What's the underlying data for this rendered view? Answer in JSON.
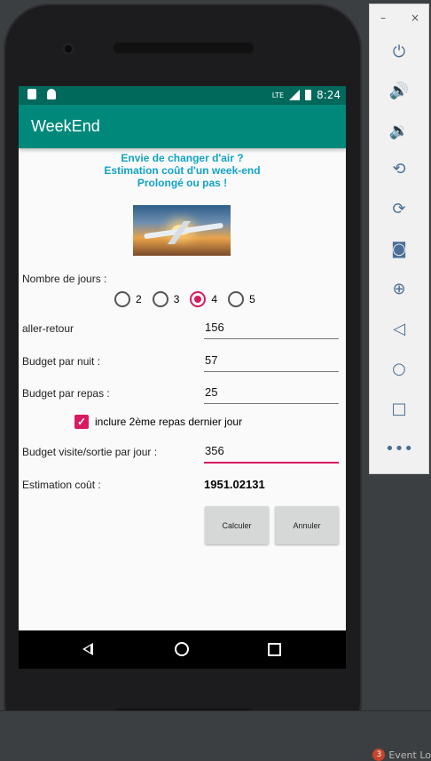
{
  "appbar": {
    "title": "WeekEnd"
  },
  "statusbar": {
    "time": "8:24",
    "network": "LTE"
  },
  "headline": {
    "line1": "Envie de changer d'air ?",
    "line2": "Estimation coût d'un week-end",
    "line3": "Prolongé ou pas !"
  },
  "form": {
    "days_label": "Nombre de jours :",
    "radios": [
      "2",
      "3",
      "4",
      "5"
    ],
    "selected": "4",
    "aller_label": "aller-retour",
    "aller_value": "156",
    "nuit_label": "Budget par nuit :",
    "nuit_value": "57",
    "repas_label": "Budget par repas :",
    "repas_value": "25",
    "checkbox_label": "inclure 2ème repas dernier jour",
    "visite_label": "Budget visite/sortie par jour :",
    "visite_value": "356",
    "estimation_label": "Estimation coût :",
    "estimation_value": "1951.02131"
  },
  "buttons": {
    "calculer": "Calculer",
    "annuler": "Annuler"
  },
  "emulator": {
    "minimize": "–",
    "close": "×"
  },
  "footer": {
    "badge": "3",
    "event_log": "Event Lo"
  },
  "colors": {
    "primary": "#00897b",
    "primary_dark": "#00695c",
    "accent": "#d81b60",
    "headline": "#13a3c4"
  }
}
